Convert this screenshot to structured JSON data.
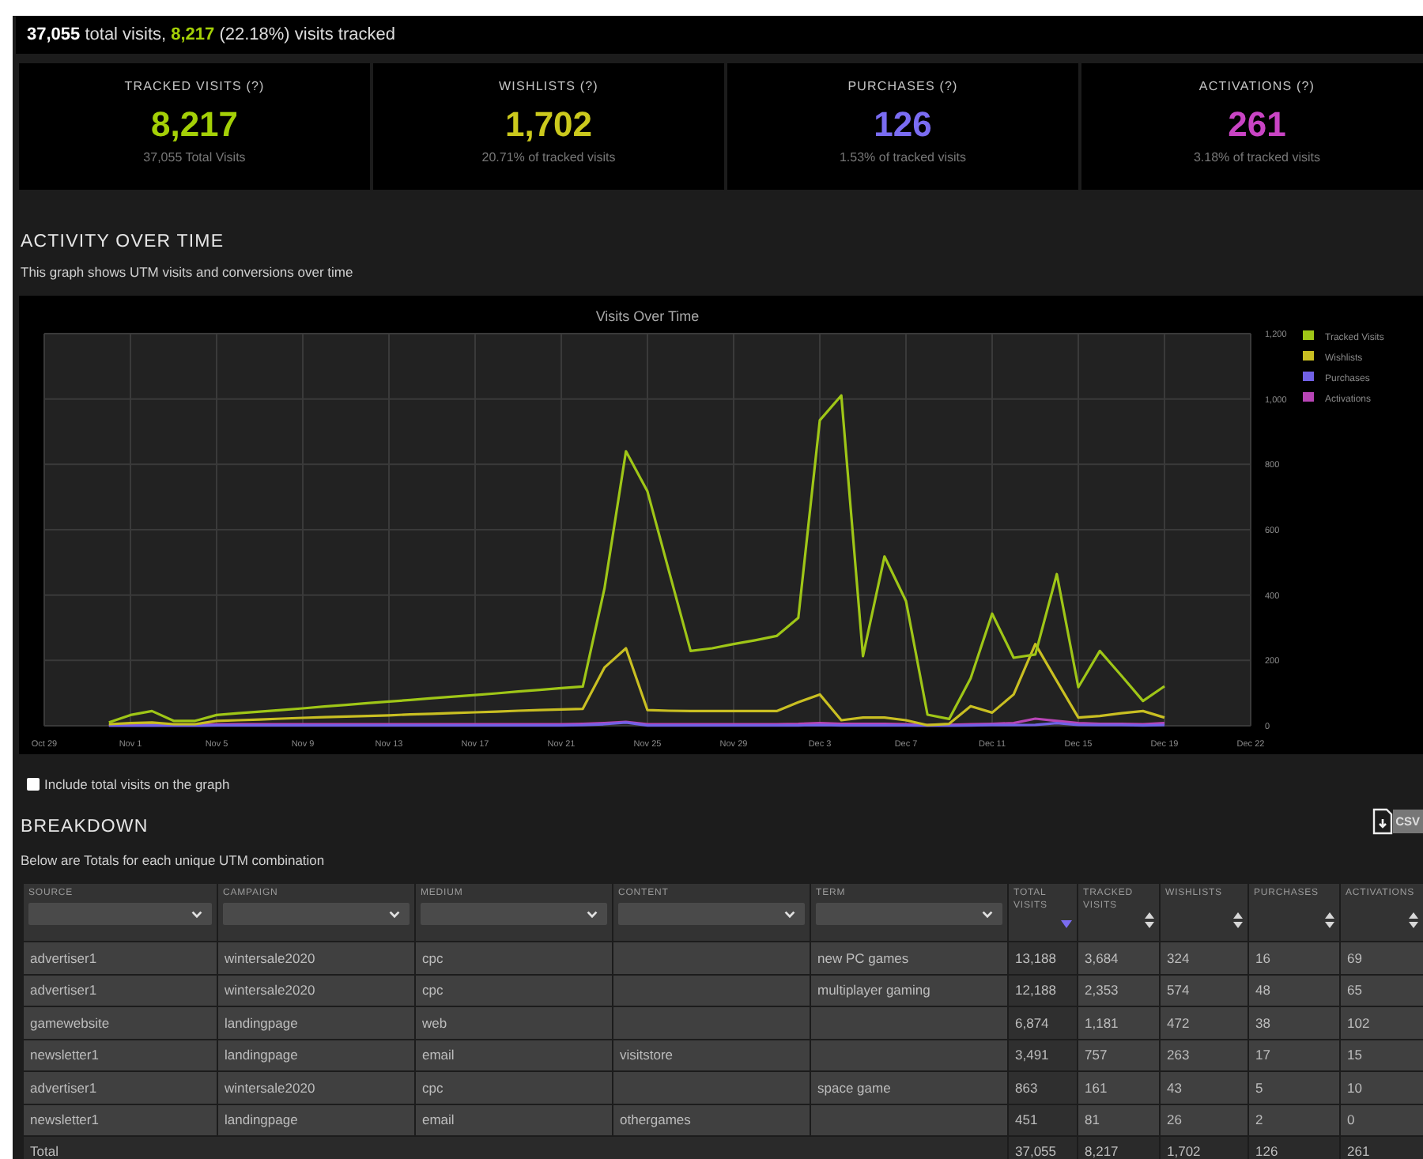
{
  "summary": {
    "total_visits": "37,055",
    "total_label": "total visits,",
    "tracked_visits": "8,217",
    "tracked_label": "(22.18%) visits tracked"
  },
  "stats": [
    {
      "title": "TRACKED VISITS (?)",
      "value": "8,217",
      "caption": "37,055 Total Visits",
      "color": "#a4d007"
    },
    {
      "title": "WISHLISTS (?)",
      "value": "1,702",
      "caption": "20.71% of tracked visits",
      "color": "#cbc91d"
    },
    {
      "title": "PURCHASES (?)",
      "value": "126",
      "caption": "1.53% of tracked visits",
      "color": "#7a6cf2"
    },
    {
      "title": "ACTIVATIONS (?)",
      "value": "261",
      "caption": "3.18% of tracked visits",
      "color": "#c944c4"
    }
  ],
  "activity": {
    "heading": "ACTIVITY OVER TIME",
    "description": "This graph shows UTM visits and conversions over time",
    "chart_data": {
      "type": "line",
      "title": "Visits Over Time",
      "ylim": [
        0,
        1200
      ],
      "grid": true,
      "legend": true,
      "categories": [
        "Oct 29",
        null,
        null,
        null,
        "Nov 1",
        null,
        null,
        null,
        "Nov 5",
        null,
        null,
        null,
        "Nov 9",
        null,
        null,
        null,
        "Nov 13",
        null,
        null,
        null,
        "Nov 17",
        null,
        null,
        null,
        "Nov 21",
        null,
        null,
        null,
        "Nov 25",
        null,
        null,
        null,
        "Nov 29",
        null,
        null,
        null,
        "Dec 3",
        null,
        null,
        null,
        "Dec 7",
        null,
        null,
        null,
        "Dec 11",
        null,
        null,
        null,
        "Dec 15",
        null,
        null,
        null,
        "Dec 19",
        null,
        null,
        null,
        "Dec 22"
      ],
      "yticks": [
        0,
        200,
        400,
        600,
        800,
        {
          "value": 1000,
          "label": "1,000"
        },
        {
          "value": 1200,
          "label": "1,200"
        }
      ],
      "series": [
        {
          "name": "Tracked Visits",
          "color": "#9fc617",
          "values": [
            null,
            null,
            null,
            10,
            33,
            45,
            15,
            15,
            33,
            38,
            43,
            48,
            53,
            59,
            64,
            69,
            74,
            79,
            84,
            89,
            94,
            99,
            105,
            110,
            115,
            120,
            420,
            840,
            717,
            473,
            229,
            237,
            250,
            262,
            275,
            330,
            935,
            1011,
            213,
            518,
            382,
            34,
            21,
            145,
            343,
            208,
            218,
            464,
            118,
            229,
            153,
            76,
            121,
            null,
            null,
            null,
            null
          ]
        },
        {
          "name": "Wishlists",
          "color": "#c9bf22",
          "values": [
            null,
            null,
            null,
            5,
            8,
            10,
            5,
            5,
            15,
            17,
            19,
            22,
            24,
            26,
            28,
            30,
            32,
            35,
            37,
            39,
            41,
            43,
            46,
            48,
            50,
            52,
            178,
            237,
            48,
            46,
            45,
            45,
            45,
            45,
            45,
            72,
            96,
            17,
            25,
            25,
            17,
            2,
            6,
            60,
            40,
            96,
            250,
            137,
            25,
            30,
            38,
            45,
            25,
            null,
            null,
            null,
            null
          ]
        },
        {
          "name": "Purchases",
          "color": "#7161e6",
          "values": [
            null,
            null,
            null,
            0,
            0,
            1,
            0,
            0,
            1,
            1,
            1,
            1,
            1,
            1,
            1,
            1,
            1,
            1,
            1,
            1,
            1,
            1,
            1,
            1,
            1,
            2,
            5,
            10,
            1,
            1,
            1,
            1,
            1,
            1,
            1,
            1,
            2,
            1,
            1,
            1,
            1,
            0,
            0,
            1,
            2,
            2,
            3,
            8,
            3,
            2,
            2,
            1,
            2,
            null,
            null,
            null,
            null
          ]
        },
        {
          "name": "Activations",
          "color": "#b845b6",
          "values": [
            null,
            null,
            null,
            2,
            4,
            5,
            3,
            3,
            4,
            5,
            5,
            5,
            5,
            5,
            5,
            5,
            5,
            5,
            5,
            5,
            5,
            5,
            5,
            5,
            5,
            6,
            8,
            12,
            5,
            5,
            5,
            5,
            5,
            5,
            5,
            6,
            8,
            6,
            6,
            6,
            5,
            2,
            3,
            5,
            6,
            8,
            22,
            15,
            8,
            6,
            6,
            5,
            8,
            null,
            null,
            null,
            null
          ]
        }
      ]
    }
  },
  "include_total": {
    "label": "Include total visits on the graph",
    "checked": false
  },
  "breakdown": {
    "heading": "BREAKDOWN",
    "description": "Below are Totals for each unique UTM combination",
    "export_button": "CSV",
    "columns": [
      {
        "label": "SOURCE",
        "kind": "filter"
      },
      {
        "label": "CAMPAIGN",
        "kind": "filter"
      },
      {
        "label": "MEDIUM",
        "kind": "filter"
      },
      {
        "label": "CONTENT",
        "kind": "filter"
      },
      {
        "label": "TERM",
        "kind": "filter"
      },
      {
        "label": "TOTAL VISITS",
        "kind": "sort",
        "sorted": true
      },
      {
        "label": "TRACKED VISITS",
        "kind": "sort",
        "sorted": false
      },
      {
        "label": "WISHLISTS",
        "kind": "sort",
        "sorted": false
      },
      {
        "label": "PURCHASES",
        "kind": "sort",
        "sorted": false
      },
      {
        "label": "ACTIVATIONS",
        "kind": "sort",
        "sorted": false
      }
    ],
    "rows": [
      [
        "advertiser1",
        "wintersale2020",
        "cpc",
        "",
        "new PC games",
        "13,188",
        "3,684",
        "324",
        "16",
        "69"
      ],
      [
        "advertiser1",
        "wintersale2020",
        "cpc",
        "",
        "multiplayer gaming",
        "12,188",
        "2,353",
        "574",
        "48",
        "65"
      ],
      [
        "gamewebsite",
        "landingpage",
        "web",
        "",
        "",
        "6,874",
        "1,181",
        "472",
        "38",
        "102"
      ],
      [
        "newsletter1",
        "landingpage",
        "email",
        "visitstore",
        "",
        "3,491",
        "757",
        "263",
        "17",
        "15"
      ],
      [
        "advertiser1",
        "wintersale2020",
        "cpc",
        "",
        "space game",
        "863",
        "161",
        "43",
        "5",
        "10"
      ],
      [
        "newsletter1",
        "landingpage",
        "email",
        "othergames",
        "",
        "451",
        "81",
        "26",
        "2",
        "0"
      ]
    ],
    "total_row": {
      "label": "Total",
      "values": [
        "37,055",
        "8,217",
        "1,702",
        "126",
        "261"
      ]
    }
  }
}
